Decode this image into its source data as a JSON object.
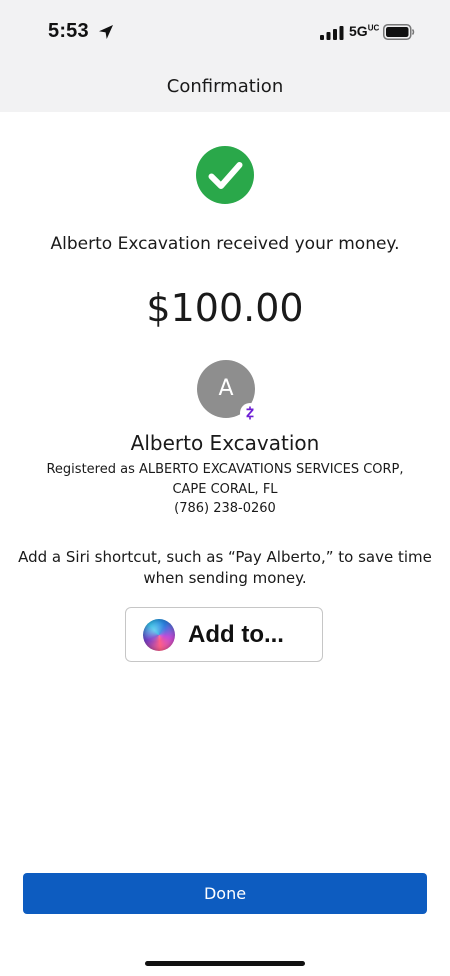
{
  "status_bar": {
    "time": "5:53",
    "network": "5G",
    "network_superscript": "UC",
    "icons": [
      "location-arrow-icon",
      "cellular-signal-icon",
      "battery-icon"
    ]
  },
  "nav": {
    "title": "Confirmation"
  },
  "confirmation": {
    "status_icon": "checkmark-circle-icon",
    "status_color": "#2aa84a",
    "message": "Alberto Excavation received your money.",
    "amount": "$100.00"
  },
  "recipient": {
    "avatar_initial": "A",
    "avatar_color": "#8e8e8e",
    "badge_icon": "zelle-icon",
    "badge_color": "#6d1ed4",
    "name": "Alberto Excavation",
    "registered_line_1": "Registered as ALBERTO EXCAVATIONS SERVICES CORP,",
    "registered_line_2": "CAPE CORAL, FL",
    "phone": "(786) 238-0260"
  },
  "siri": {
    "prompt": "Add a Siri shortcut, such as “Pay Alberto,” to save time when sending money.",
    "button_label": "Add to...",
    "icon": "siri-icon"
  },
  "actions": {
    "done_label": "Done",
    "done_color": "#0d5cc0"
  }
}
